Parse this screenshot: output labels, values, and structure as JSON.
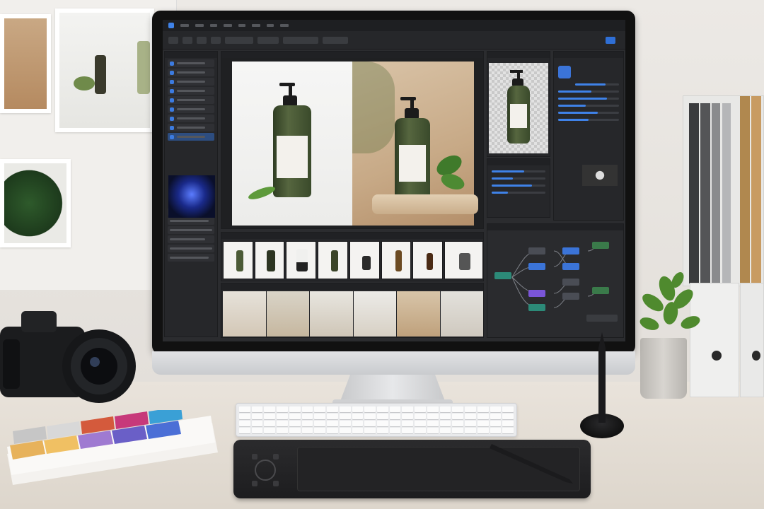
{
  "scene": "desk-with-monitor",
  "monitor_app": {
    "menu_items": [
      "",
      "",
      "",
      "",
      "",
      "",
      "",
      "",
      "",
      ""
    ],
    "panels": {
      "left_title": "",
      "canvas_title": "",
      "preview_title": "",
      "properties_title": "",
      "nodes_title": ""
    }
  },
  "colors": {
    "accent": "#3f82e8",
    "ui_dark": "#26272a",
    "bottle_green": "#4b5a36",
    "node_blue": "#3b74d8",
    "node_purple": "#7a55d8",
    "node_teal": "#2c8a78",
    "node_green": "#3a7a4a"
  },
  "icons": [
    "camera-icon",
    "stylus-icon",
    "plant-icon",
    "folder-icon"
  ]
}
